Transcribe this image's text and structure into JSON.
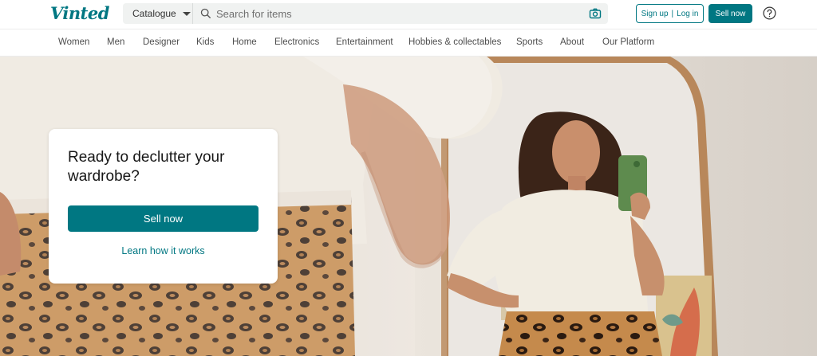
{
  "header": {
    "logo_text": "Vinted",
    "catalogue_label": "Catalogue",
    "search_placeholder": "Search for items",
    "signup_label": "Sign up",
    "login_label": "Log in",
    "separator": "|",
    "sell_now_label": "Sell now"
  },
  "nav": {
    "items": [
      "Women",
      "Men",
      "Designer",
      "Kids",
      "Home",
      "Electronics",
      "Entertainment",
      "Hobbies & collectables",
      "Sports",
      "About",
      "Our Platform"
    ]
  },
  "hero": {
    "card": {
      "title": "Ready to declutter your wardrobe?",
      "sell_button": "Sell now",
      "learn_link": "Learn how it works"
    }
  },
  "icons": {
    "search": "search-icon",
    "camera": "camera-icon",
    "help": "help-circle-icon",
    "caret": "chevron-down-icon"
  },
  "colors": {
    "brand": "#007782",
    "search_bg": "#f0f2f1"
  }
}
